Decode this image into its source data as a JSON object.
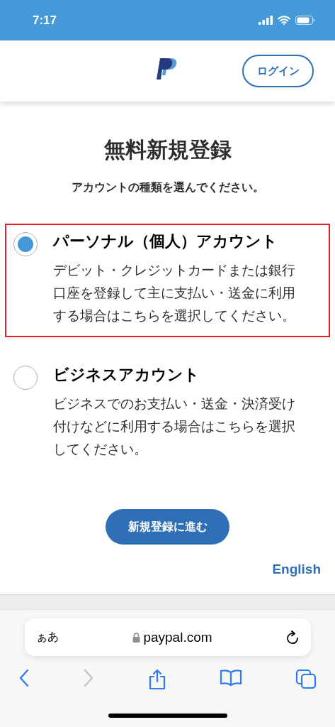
{
  "status_bar": {
    "time": "7:17"
  },
  "header": {
    "login_button": "ログイン"
  },
  "title": "無料新規登録",
  "subtitle": "アカウントの種類を選んでください。",
  "account_types": [
    {
      "title": "パーソナル（個人）アカウント",
      "description": "デビット・クレジットカードまたは銀行口座を登録して主に支払い・送金に利用する場合はこちらを選択してください。",
      "selected": true
    },
    {
      "title": "ビジネスアカウント",
      "description": "ビジネスでのお支払い・送金・決済受け付けなどに利用する場合はこちらを選択してください。",
      "selected": false
    }
  ],
  "continue_button": "新規登録に進む",
  "language_link": "English",
  "browser": {
    "text_size_button": "ぁあ",
    "url": "paypal.com",
    "forward_disabled": true
  }
}
